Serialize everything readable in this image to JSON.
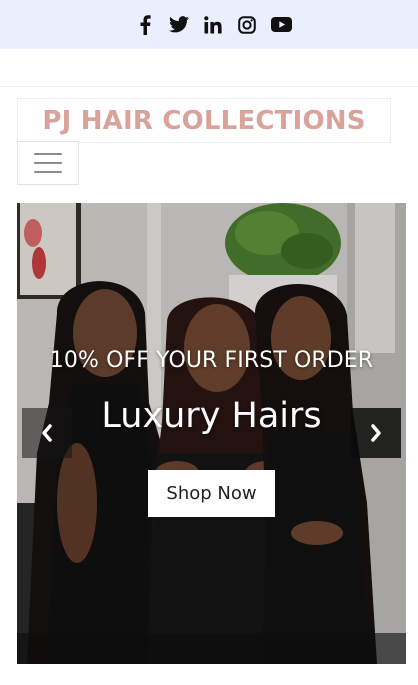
{
  "topbar": {
    "bg_color": "#ebeffd",
    "social_icons": [
      "facebook-icon",
      "twitter-icon",
      "linkedin-icon",
      "instagram-icon",
      "youtube-icon"
    ]
  },
  "brand": {
    "name": "PJ HAIR COLLECTIONS",
    "color": "#d9a39b"
  },
  "nav": {
    "toggle_icon": "hamburger-menu-icon"
  },
  "hero": {
    "image": "three-women-with-long-straight-hair",
    "subtitle": "10% OFF YOUR FIRST ORDER",
    "title": "Luxury Hairs",
    "cta_label": "Shop Now",
    "prev_icon": "chevron-left-icon",
    "next_icon": "chevron-right-icon"
  }
}
